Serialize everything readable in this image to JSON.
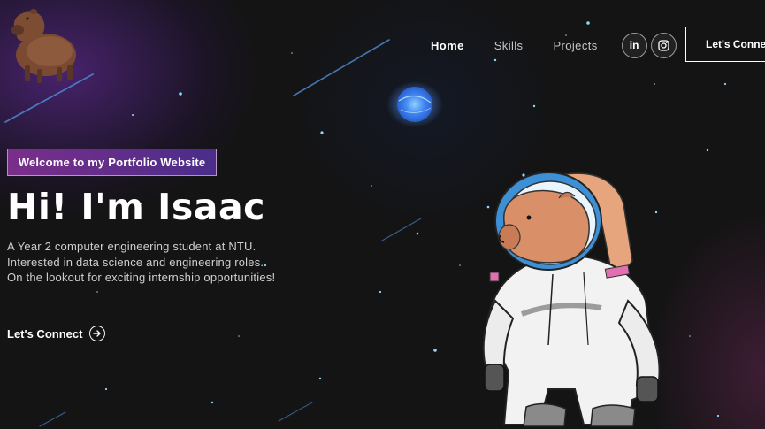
{
  "nav": {
    "links": [
      "Home",
      "Skills",
      "Projects"
    ],
    "active": "Home",
    "social": [
      {
        "name": "linkedin",
        "label": "in"
      },
      {
        "name": "instagram",
        "icon": "instagram-icon"
      }
    ],
    "connect_label": "Let's Connect"
  },
  "hero": {
    "tagline": "Welcome to my Portfolio Website",
    "title": "Hi! I'm Isaac",
    "description": [
      "A Year 2 computer engineering student at NTU.",
      "Interested in data science and engineering roles.",
      "On the lookout for exciting internship opportunities!"
    ],
    "cta_label": "Let's Connect",
    "cta_icon": "arrow-right-circle-icon"
  },
  "images": {
    "logo": "capybara-logo",
    "astronaut": "capybara-astronaut-illustration",
    "planet": "glowing-blue-planet"
  },
  "colors": {
    "background": "#141414",
    "tagline_gradient_start": "#7a2f8a",
    "tagline_gradient_end": "#4a2d8a",
    "planet": "#4a9cff"
  }
}
